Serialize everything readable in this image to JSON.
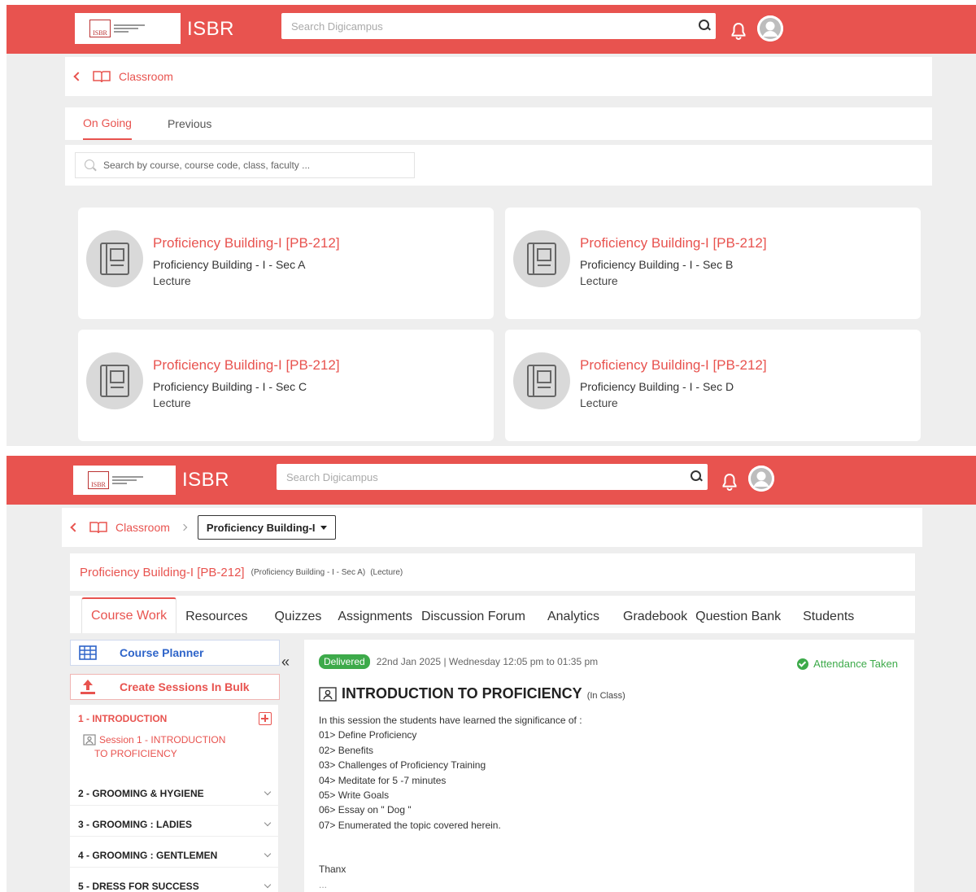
{
  "app": {
    "brand": "ISBR",
    "logo_text": "ISBR",
    "search_placeholder": "Search Digicampus"
  },
  "classroom": {
    "breadcrumb": "Classroom",
    "tabs": [
      {
        "label": "On Going",
        "active": true
      },
      {
        "label": "Previous",
        "active": false
      }
    ],
    "search_placeholder": "Search by course, course code, class, faculty ...",
    "cards": [
      {
        "title": "Proficiency Building-I [PB-212]",
        "subtitle": "Proficiency Building - I - Sec A",
        "type": "Lecture"
      },
      {
        "title": "Proficiency Building-I [PB-212]",
        "subtitle": "Proficiency Building - I - Sec B",
        "type": "Lecture"
      },
      {
        "title": "Proficiency Building-I [PB-212]",
        "subtitle": "Proficiency Building - I - Sec C",
        "type": "Lecture"
      },
      {
        "title": "Proficiency Building-I [PB-212]",
        "subtitle": "Proficiency Building - I - Sec D",
        "type": "Lecture"
      }
    ]
  },
  "course": {
    "breadcrumb": "Classroom",
    "dropdown_value": "Proficiency Building-I",
    "title": "Proficiency Building-I [PB-212]",
    "section_meta": "(Proficiency Building - I - Sec A)",
    "type_meta": "(Lecture)",
    "tabs": [
      {
        "label": "Course Work",
        "active": true
      },
      {
        "label": "Resources"
      },
      {
        "label": "Quizzes"
      },
      {
        "label": "Assignments"
      },
      {
        "label": "Discussion Forum"
      },
      {
        "label": "Analytics"
      },
      {
        "label": "Gradebook"
      },
      {
        "label": "Question Bank"
      },
      {
        "label": "Students"
      }
    ],
    "sidebar": {
      "course_planner": "Course Planner",
      "bulk_sessions": "Create Sessions In Bulk",
      "collapse_glyph": "«",
      "active_section": "1 - INTRODUCTION",
      "active_session_line1": "Session 1 - INTRODUCTION",
      "active_session_line2": "TO PROFICIENCY",
      "sections": [
        "2 - GROOMING & HYGIENE",
        "3 - GROOMING : LADIES",
        "4 - GROOMING : GENTLEMEN",
        "5 - DRESS FOR SUCCESS"
      ]
    },
    "session": {
      "status": "Delivered",
      "datetime": "22nd Jan 2025 | Wednesday 12:05 pm to 01:35 pm",
      "attendance": "Attendance Taken",
      "title": "INTRODUCTION TO PROFICIENCY",
      "mode": "(In Class)",
      "body": [
        "In this session the students have learned the significance of :",
        "01> Define Proficiency",
        "02> Benefits",
        "03> Challenges of Proficiency Training",
        "04> Meditate for 5 -7 minutes",
        "05> Write Goals",
        "06> Essay on \" Dog \"",
        "07> Enumerated the topic covered herein."
      ],
      "sign_off": "Thanx",
      "trailing": "..."
    },
    "colors": {
      "accent": "#e8534f",
      "success": "#3daa4a",
      "planner_blue": "#2e64c9"
    }
  }
}
